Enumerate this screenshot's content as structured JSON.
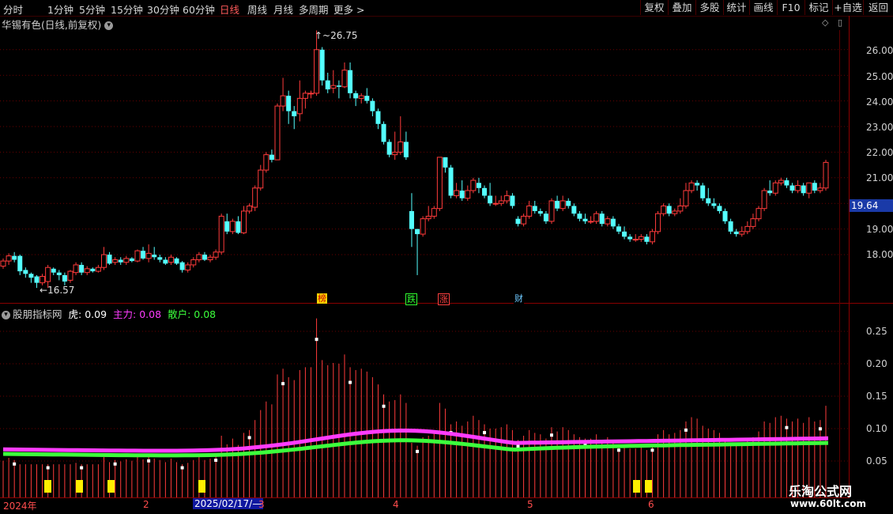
{
  "toolbar": {
    "periods": [
      "分时",
      "1分钟",
      "5分钟",
      "15分钟",
      "30分钟",
      "60分钟",
      "日线",
      "周线",
      "月线",
      "多周期",
      "更多 >"
    ],
    "active_period": "日线",
    "buttons": [
      "复权",
      "叠加",
      "多股",
      "统计",
      "画线",
      "F10",
      "标记",
      "+自选",
      "返回"
    ]
  },
  "main_chart": {
    "title": "华锡有色(日线,前复权)",
    "high_label": "26.75",
    "low_label": "16.57",
    "current_price": "19.64",
    "y_ticks": [
      "26.00",
      "25.00",
      "24.00",
      "23.00",
      "22.00",
      "21.00",
      "19.00",
      "18.00"
    ],
    "events": [
      "榜",
      "跌",
      "涨",
      "财"
    ],
    "colors": {
      "up": "#ff3b3b",
      "down": "#54ffff",
      "grid": "#6a0000"
    }
  },
  "indicator": {
    "name": "股朋指标网",
    "s1_label": "虎:",
    "s1_value": "0.09",
    "s2_label": "主力:",
    "s2_value": "0.08",
    "s3_label": "散户:",
    "s3_value": "0.08",
    "y_ticks": [
      "0.25",
      "0.20",
      "0.15",
      "0.10",
      "0.05"
    ],
    "colors": {
      "s1": "#ffffff",
      "s2": "#ff3cff",
      "s3": "#3cff3c"
    }
  },
  "x_axis": {
    "labels": [
      "2024年",
      "2",
      "3",
      "4",
      "5",
      "6"
    ],
    "cursor_date": "2025/02/17/—"
  },
  "watermark": {
    "line1": "乐淘公式网",
    "line2": "www.60lt.com"
  },
  "chart_data": {
    "type": "candlestick",
    "candles": [
      [
        17.55,
        17.75,
        17.45,
        17.85
      ],
      [
        17.75,
        17.95,
        17.6,
        18.05
      ],
      [
        17.95,
        17.8,
        17.7,
        18.1
      ],
      [
        17.95,
        17.35,
        17.2,
        18.0
      ],
      [
        17.4,
        17.25,
        17.1,
        17.5
      ],
      [
        17.25,
        17.1,
        16.9,
        17.3
      ],
      [
        17.15,
        16.9,
        16.7,
        17.2
      ],
      [
        16.9,
        17.15,
        16.8,
        17.25
      ],
      [
        16.95,
        17.5,
        16.7,
        17.6
      ],
      [
        17.45,
        17.3,
        17.2,
        17.5
      ],
      [
        17.3,
        17.2,
        17.0,
        17.4
      ],
      [
        17.2,
        16.95,
        16.8,
        17.3
      ],
      [
        17.0,
        17.35,
        16.9,
        17.4
      ],
      [
        17.3,
        17.6,
        17.2,
        17.7
      ],
      [
        17.6,
        17.3,
        17.2,
        17.7
      ],
      [
        17.3,
        17.45,
        17.2,
        17.55
      ],
      [
        17.45,
        17.35,
        17.3,
        17.5
      ],
      [
        17.35,
        17.5,
        17.3,
        17.6
      ],
      [
        17.5,
        18.0,
        17.4,
        18.3
      ],
      [
        18.0,
        17.65,
        17.6,
        18.1
      ],
      [
        17.7,
        17.8,
        17.6,
        17.9
      ],
      [
        17.8,
        17.7,
        17.6,
        17.9
      ],
      [
        17.7,
        17.85,
        17.6,
        17.95
      ],
      [
        17.85,
        17.75,
        17.7,
        17.9
      ],
      [
        17.75,
        18.15,
        17.7,
        18.2
      ],
      [
        18.15,
        17.85,
        17.8,
        18.3
      ],
      [
        17.85,
        18.05,
        17.7,
        18.4
      ],
      [
        18.0,
        17.9,
        17.8,
        18.3
      ],
      [
        17.9,
        17.8,
        17.7,
        18.0
      ],
      [
        17.8,
        17.65,
        17.6,
        17.9
      ],
      [
        17.7,
        17.9,
        17.6,
        18.0
      ],
      [
        17.85,
        17.65,
        17.6,
        17.9
      ],
      [
        17.7,
        17.4,
        17.3,
        17.75
      ],
      [
        17.4,
        17.6,
        17.3,
        17.7
      ],
      [
        17.6,
        17.8,
        17.5,
        17.9
      ],
      [
        17.8,
        18.0,
        17.7,
        18.1
      ],
      [
        18.0,
        17.8,
        17.75,
        18.1
      ],
      [
        17.8,
        17.9,
        17.7,
        18.0
      ],
      [
        17.9,
        18.1,
        17.8,
        18.2
      ],
      [
        18.1,
        19.5,
        18.0,
        19.6
      ],
      [
        19.3,
        18.9,
        18.8,
        19.6
      ],
      [
        18.9,
        19.3,
        18.8,
        19.4
      ],
      [
        19.3,
        18.85,
        18.8,
        19.5
      ],
      [
        18.85,
        19.7,
        18.8,
        19.9
      ],
      [
        19.7,
        19.9,
        19.6,
        20.0
      ],
      [
        19.85,
        20.6,
        19.7,
        20.7
      ],
      [
        20.6,
        21.3,
        20.5,
        21.5
      ],
      [
        21.3,
        21.9,
        21.2,
        22.0
      ],
      [
        21.9,
        21.7,
        21.6,
        22.1
      ],
      [
        21.7,
        23.8,
        21.7,
        23.9
      ],
      [
        23.8,
        24.2,
        23.6,
        24.9
      ],
      [
        24.2,
        23.6,
        23.1,
        24.4
      ],
      [
        23.6,
        23.4,
        22.9,
        23.8
      ],
      [
        23.5,
        24.1,
        23.2,
        24.8
      ],
      [
        24.1,
        24.3,
        23.7,
        24.4
      ],
      [
        24.3,
        24.3,
        24.1,
        24.4
      ],
      [
        24.3,
        26.0,
        24.2,
        26.75
      ],
      [
        26.0,
        24.8,
        24.6,
        26.1
      ],
      [
        24.8,
        24.45,
        24.3,
        25.1
      ],
      [
        24.5,
        24.6,
        24.3,
        25.2
      ],
      [
        24.6,
        24.55,
        24.1,
        24.8
      ],
      [
        24.55,
        25.2,
        24.5,
        25.5
      ],
      [
        25.2,
        24.3,
        24.1,
        25.5
      ],
      [
        24.3,
        24.1,
        23.8,
        24.4
      ],
      [
        24.1,
        24.2,
        23.9,
        24.3
      ],
      [
        24.2,
        24.0,
        23.9,
        24.5
      ],
      [
        24.0,
        23.6,
        23.4,
        24.1
      ],
      [
        23.6,
        23.1,
        22.9,
        23.7
      ],
      [
        23.1,
        22.4,
        22.3,
        23.2
      ],
      [
        22.4,
        21.9,
        21.8,
        22.5
      ],
      [
        21.9,
        22.0,
        21.7,
        22.8
      ],
      [
        22.0,
        22.4,
        21.9,
        23.4
      ],
      [
        22.4,
        21.8,
        21.7,
        22.8
      ],
      [
        19.7,
        19.0,
        18.3,
        20.4
      ],
      [
        19.0,
        18.8,
        17.2,
        19.0
      ],
      [
        18.8,
        19.4,
        18.7,
        19.5
      ],
      [
        19.4,
        19.5,
        19.3,
        19.9
      ],
      [
        19.5,
        19.8,
        19.4,
        19.9
      ],
      [
        19.8,
        21.8,
        19.7,
        21.8
      ],
      [
        21.8,
        21.4,
        21.2,
        21.8
      ],
      [
        21.4,
        20.3,
        20.2,
        21.5
      ],
      [
        20.3,
        20.5,
        20.2,
        20.8
      ],
      [
        20.5,
        20.2,
        20.1,
        20.9
      ],
      [
        20.2,
        20.5,
        20.1,
        20.7
      ],
      [
        20.5,
        20.9,
        20.4,
        21.0
      ],
      [
        20.8,
        20.6,
        20.4,
        21.0
      ],
      [
        20.6,
        20.3,
        20.2,
        20.7
      ],
      [
        20.3,
        20.0,
        19.9,
        20.8
      ],
      [
        20.0,
        20.0,
        19.9,
        20.3
      ],
      [
        20.0,
        20.1,
        19.9,
        20.3
      ],
      [
        20.1,
        20.3,
        20.0,
        20.5
      ],
      [
        20.3,
        19.9,
        19.8,
        20.4
      ],
      [
        19.4,
        19.2,
        19.1,
        19.5
      ],
      [
        19.2,
        19.5,
        19.1,
        19.6
      ],
      [
        19.5,
        19.9,
        19.4,
        20.1
      ],
      [
        19.9,
        19.7,
        19.6,
        20.1
      ],
      [
        19.7,
        19.6,
        19.5,
        19.8
      ],
      [
        19.6,
        19.3,
        19.2,
        19.7
      ],
      [
        19.3,
        20.1,
        19.2,
        20.2
      ],
      [
        20.1,
        19.8,
        19.7,
        20.3
      ],
      [
        19.8,
        20.1,
        19.7,
        20.3
      ],
      [
        20.1,
        19.9,
        19.8,
        20.2
      ],
      [
        19.9,
        19.6,
        19.5,
        20.0
      ],
      [
        19.6,
        19.4,
        19.3,
        19.7
      ],
      [
        19.4,
        19.3,
        19.2,
        19.6
      ],
      [
        19.3,
        19.3,
        19.2,
        19.5
      ],
      [
        19.3,
        19.6,
        19.2,
        19.7
      ],
      [
        19.6,
        19.2,
        19.1,
        19.7
      ],
      [
        19.2,
        19.4,
        19.1,
        19.5
      ],
      [
        19.4,
        19.1,
        19.0,
        19.5
      ],
      [
        19.1,
        18.9,
        18.8,
        19.2
      ],
      [
        18.9,
        18.7,
        18.6,
        19.1
      ],
      [
        18.7,
        18.6,
        18.5,
        18.8
      ],
      [
        18.6,
        18.6,
        18.5,
        18.8
      ],
      [
        18.6,
        18.7,
        18.5,
        18.8
      ],
      [
        18.7,
        18.5,
        18.4,
        18.8
      ],
      [
        18.5,
        18.9,
        18.4,
        19.0
      ],
      [
        18.9,
        19.6,
        18.8,
        19.7
      ],
      [
        19.6,
        19.9,
        19.5,
        20.0
      ],
      [
        19.9,
        19.6,
        19.5,
        20.0
      ],
      [
        19.6,
        19.7,
        19.5,
        19.8
      ],
      [
        19.7,
        19.9,
        19.6,
        20.2
      ],
      [
        19.9,
        20.5,
        19.8,
        20.8
      ],
      [
        20.5,
        20.8,
        20.4,
        20.9
      ],
      [
        20.8,
        20.7,
        20.5,
        20.9
      ],
      [
        20.7,
        20.2,
        20.1,
        20.8
      ],
      [
        20.2,
        20.0,
        19.9,
        20.6
      ],
      [
        20.0,
        19.9,
        19.8,
        20.2
      ],
      [
        19.9,
        19.7,
        19.6,
        20.0
      ],
      [
        19.7,
        19.3,
        19.2,
        19.8
      ],
      [
        19.3,
        18.9,
        18.8,
        19.4
      ],
      [
        18.9,
        18.8,
        18.7,
        19.0
      ],
      [
        18.8,
        18.9,
        18.7,
        19.1
      ],
      [
        18.9,
        19.1,
        18.8,
        19.3
      ],
      [
        19.1,
        19.4,
        19.0,
        19.6
      ],
      [
        19.4,
        19.8,
        19.3,
        19.9
      ],
      [
        19.8,
        20.5,
        19.7,
        20.6
      ],
      [
        20.5,
        20.4,
        20.3,
        20.9
      ],
      [
        20.4,
        20.8,
        20.3,
        20.9
      ],
      [
        20.8,
        20.9,
        20.7,
        21.0
      ],
      [
        20.9,
        20.7,
        20.6,
        21.0
      ],
      [
        20.7,
        20.5,
        20.4,
        20.8
      ],
      [
        20.5,
        20.7,
        20.4,
        20.9
      ],
      [
        20.7,
        20.4,
        20.3,
        20.8
      ],
      [
        20.4,
        20.8,
        20.2,
        20.8
      ],
      [
        20.8,
        20.5,
        20.4,
        20.9
      ],
      [
        20.5,
        20.6,
        20.4,
        20.8
      ],
      [
        20.6,
        21.6,
        20.5,
        21.7
      ]
    ]
  }
}
